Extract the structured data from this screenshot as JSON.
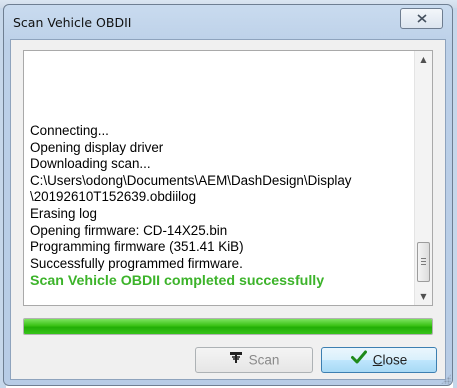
{
  "window": {
    "title": "Scan Vehicle OBDII",
    "close_glyph": "X"
  },
  "log": {
    "lines": [
      "Connecting...",
      "Opening display driver",
      "Downloading scan...",
      "C:\\Users\\odong\\Documents\\AEM\\DashDesign\\Display",
      "\\20192610T152639.obdiilog",
      "Erasing log",
      "Opening firmware: CD-14X25.bin",
      "Programming firmware (351.41 KiB)",
      "Successfully programmed firmware."
    ],
    "success_message": "Scan Vehicle OBDII completed successfully",
    "success_color": "#3cb32a"
  },
  "progress": {
    "percent": 100,
    "color": "#2bb80c"
  },
  "buttons": {
    "scan_label": "Scan",
    "scan_icon": "antenna-icon",
    "scan_enabled": false,
    "close_label_prefix": "",
    "close_label_underlined": "C",
    "close_label_rest": "lose",
    "close_icon": "checkmark-icon"
  }
}
